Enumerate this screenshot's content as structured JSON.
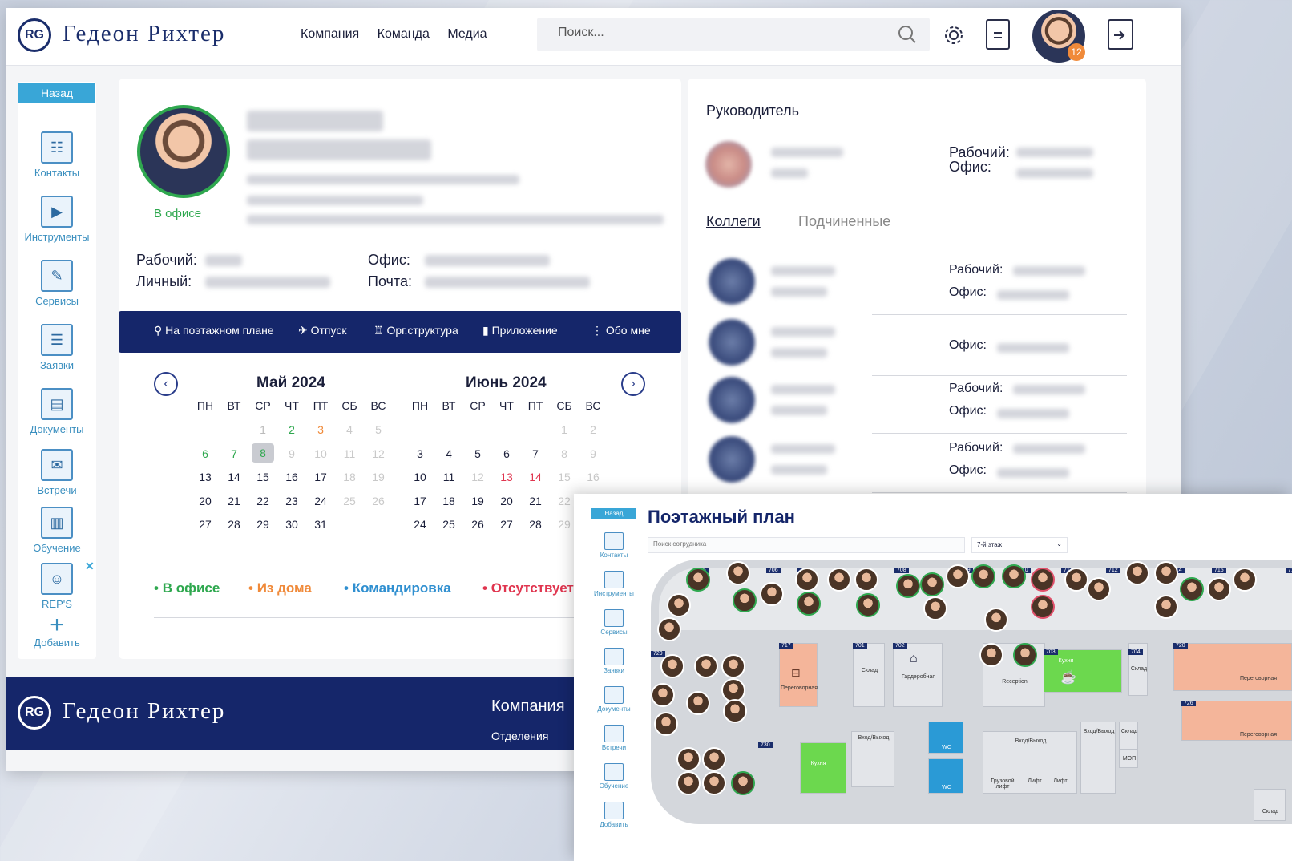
{
  "brand": {
    "logo_text": "Гедеон Рихтер",
    "logo_mark": "RG"
  },
  "nav": [
    "Компания",
    "Команда",
    "Медиа"
  ],
  "search": {
    "placeholder": "Поиск..."
  },
  "header": {
    "notification_count": "12"
  },
  "sidebar": {
    "back": "Назад",
    "items": [
      "Контакты",
      "Инструменты",
      "Сервисы",
      "Заявки",
      "Документы",
      "Встречи",
      "Обучение",
      "REP'S",
      "Добавить"
    ]
  },
  "profile": {
    "status": "В офисе",
    "work_label": "Рабочий:",
    "personal_label": "Личный:",
    "office_label": "Офис:",
    "mail_label": "Почта:"
  },
  "actions": [
    "На поэтажном плане",
    "Отпуск",
    "Орг.структура",
    "Приложение",
    "Обо мне"
  ],
  "calendar": {
    "weekdays": [
      "ПН",
      "ВТ",
      "СР",
      "ЧТ",
      "ПТ",
      "СБ",
      "ВС"
    ],
    "months": [
      {
        "title": "Май 2024",
        "weeks": [
          [
            "",
            "",
            "1",
            "2",
            "3",
            "4",
            "5"
          ],
          [
            "6",
            "7",
            "8",
            "9",
            "10",
            "11",
            "12"
          ],
          [
            "13",
            "14",
            "15",
            "16",
            "17",
            "18",
            "19"
          ],
          [
            "20",
            "21",
            "22",
            "23",
            "24",
            "25",
            "26"
          ],
          [
            "27",
            "28",
            "29",
            "30",
            "31",
            "",
            ""
          ]
        ]
      },
      {
        "title": "Июнь 2024",
        "weeks": [
          [
            "",
            "",
            "",
            "",
            "",
            "1",
            "2"
          ],
          [
            "3",
            "4",
            "5",
            "6",
            "7",
            "8",
            "9"
          ],
          [
            "10",
            "11",
            "12",
            "13",
            "14",
            "15",
            "16"
          ],
          [
            "17",
            "18",
            "19",
            "20",
            "21",
            "22",
            "23"
          ],
          [
            "24",
            "25",
            "26",
            "27",
            "28",
            "29",
            ""
          ]
        ]
      }
    ]
  },
  "legend": [
    {
      "label": "В офисе",
      "color": "#2fa84f"
    },
    {
      "label": "Из дома",
      "color": "#f08a3a"
    },
    {
      "label": "Командировка",
      "color": "#2f8fd0"
    },
    {
      "label": "Отсутствует",
      "color": "#e0354f"
    }
  ],
  "right": {
    "manager_title": "Руководитель",
    "tabs": [
      "Коллеги",
      "Подчиненные"
    ],
    "work_label": "Рабочий:",
    "office_label": "Офис:"
  },
  "footer": {
    "logo_text": "Гедеон Рихтер",
    "company": "Компания",
    "divisions": "Отделения"
  },
  "plan": {
    "title": "Поэтажный план",
    "search_placeholder": "Поиск сотрудника",
    "floor": "7-й этаж",
    "back": "Назад",
    "sidebar": [
      "Контакты",
      "Инструменты",
      "Сервисы",
      "Заявки",
      "Документы",
      "Встречи",
      "Обучение",
      "Добавить"
    ],
    "rooms": {
      "meeting": "Переговорная",
      "storage": "Склад",
      "wardrobe": "Гардеробная",
      "reception": "Reception",
      "kitchen": "Кухня",
      "entry": "Вход/Выход",
      "wc": "WC",
      "cargo_lift": "Грузовой лифт",
      "lift": "Лифт",
      "mop": "МОП"
    },
    "room_numbers": [
      "705",
      "706",
      "707",
      "708",
      "709",
      "710",
      "711",
      "712",
      "713",
      "714",
      "715",
      "716",
      "717",
      "701",
      "702",
      "703",
      "704",
      "720",
      "726",
      "729",
      "730"
    ]
  }
}
